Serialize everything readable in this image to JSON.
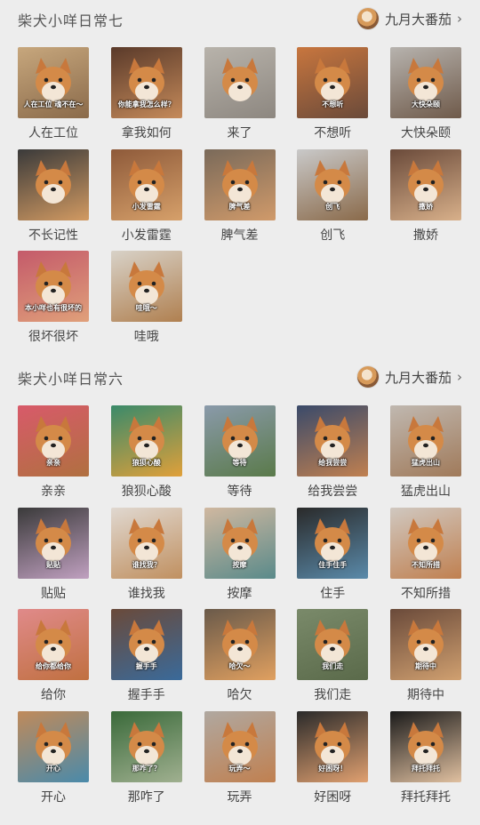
{
  "sections": [
    {
      "title": "柴犬小咩日常七",
      "author": "九月大番茄",
      "items": [
        {
          "label": "人在工位",
          "caption": "人在工位 魂不在～",
          "bg": [
            "#c7a77d",
            "#8a6a4a"
          ]
        },
        {
          "label": "拿我如何",
          "caption": "你能拿我怎么样？",
          "bg": [
            "#5a3a2a",
            "#c58a5a"
          ]
        },
        {
          "label": "来了",
          "caption": "",
          "bg": [
            "#b8b3ab",
            "#8d8780"
          ]
        },
        {
          "label": "不想听",
          "caption": "不想听",
          "bg": [
            "#c8763e",
            "#6a4a3a"
          ]
        },
        {
          "label": "大快朵颐",
          "caption": "大快朵颐",
          "bg": [
            "#b7b3ae",
            "#6f5a4a"
          ]
        },
        {
          "label": "不长记性",
          "caption": "",
          "bg": [
            "#3a3a3a",
            "#d29a62"
          ]
        },
        {
          "label": "小发雷霆",
          "caption": "小发雷霆",
          "bg": [
            "#8e5a3a",
            "#d6a06a"
          ]
        },
        {
          "label": "脾气差",
          "caption": "脾气差",
          "bg": [
            "#7a6a5a",
            "#d09a6a"
          ]
        },
        {
          "label": "创飞",
          "caption": "创飞",
          "bg": [
            "#c9c9c9",
            "#8a6a4a"
          ]
        },
        {
          "label": "撒娇",
          "caption": "撒娇",
          "bg": [
            "#6a4a3a",
            "#d8b08a"
          ]
        },
        {
          "label": "很坏很坏",
          "caption": "本小咩也有很坏的",
          "bg": [
            "#c45a6a",
            "#e0a07a"
          ]
        },
        {
          "label": "哇哦",
          "caption": "哇哦～",
          "bg": [
            "#d8d2c8",
            "#b08050"
          ]
        }
      ]
    },
    {
      "title": "柴犬小咩日常六",
      "author": "九月大番茄",
      "items": [
        {
          "label": "亲亲",
          "caption": "亲亲",
          "bg": [
            "#d85a6a",
            "#b07040"
          ]
        },
        {
          "label": "狼狈心酸",
          "caption": "狼狈心酸",
          "bg": [
            "#3a8a6a",
            "#e0a03a"
          ]
        },
        {
          "label": "等待",
          "caption": "等待",
          "bg": [
            "#8a9aaa",
            "#5a7a4a"
          ]
        },
        {
          "label": "给我尝尝",
          "caption": "给我尝尝",
          "bg": [
            "#3a4a6a",
            "#c08050"
          ]
        },
        {
          "label": "猛虎出山",
          "caption": "猛虎出山",
          "bg": [
            "#c0b8b0",
            "#a07a5a"
          ]
        },
        {
          "label": "贴贴",
          "caption": "贴贴",
          "bg": [
            "#3a3a3a",
            "#c0a0c0"
          ]
        },
        {
          "label": "谁找我",
          "caption": "谁找我？",
          "bg": [
            "#e0d8d0",
            "#c09060"
          ]
        },
        {
          "label": "按摩",
          "caption": "按摩",
          "bg": [
            "#d0b8a0",
            "#5a8a8a"
          ]
        },
        {
          "label": "住手",
          "caption": "住手住手",
          "bg": [
            "#2a2a2a",
            "#5a8aaa"
          ]
        },
        {
          "label": "不知所措",
          "caption": "不知所措",
          "bg": [
            "#d0c8c0",
            "#c08050"
          ]
        },
        {
          "label": "给你",
          "caption": "给你都给你",
          "bg": [
            "#e08a8a",
            "#c07040"
          ]
        },
        {
          "label": "握手手",
          "caption": "握手手",
          "bg": [
            "#6a4a3a",
            "#3a6a9a"
          ]
        },
        {
          "label": "哈欠",
          "caption": "哈欠～",
          "bg": [
            "#6a5a4a",
            "#e0a060"
          ]
        },
        {
          "label": "我们走",
          "caption": "我们走",
          "bg": [
            "#7a8a6a",
            "#5a6a4a"
          ]
        },
        {
          "label": "期待中",
          "caption": "期待中",
          "bg": [
            "#6a4a3a",
            "#d0a070"
          ]
        },
        {
          "label": "开心",
          "caption": "开心",
          "bg": [
            "#c08a5a",
            "#4a8aaa"
          ]
        },
        {
          "label": "那咋了",
          "caption": "那咋了？",
          "bg": [
            "#3a6a3a",
            "#a0b090"
          ]
        },
        {
          "label": "玩弄",
          "caption": "玩弄～",
          "bg": [
            "#b0a8a0",
            "#c08050"
          ]
        },
        {
          "label": "好困呀",
          "caption": "好困呀！",
          "bg": [
            "#2a2a2a",
            "#e0a070"
          ]
        },
        {
          "label": "拜托拜托",
          "caption": "拜托拜托",
          "bg": [
            "#1a1a1a",
            "#e0c0a0"
          ]
        }
      ]
    }
  ]
}
